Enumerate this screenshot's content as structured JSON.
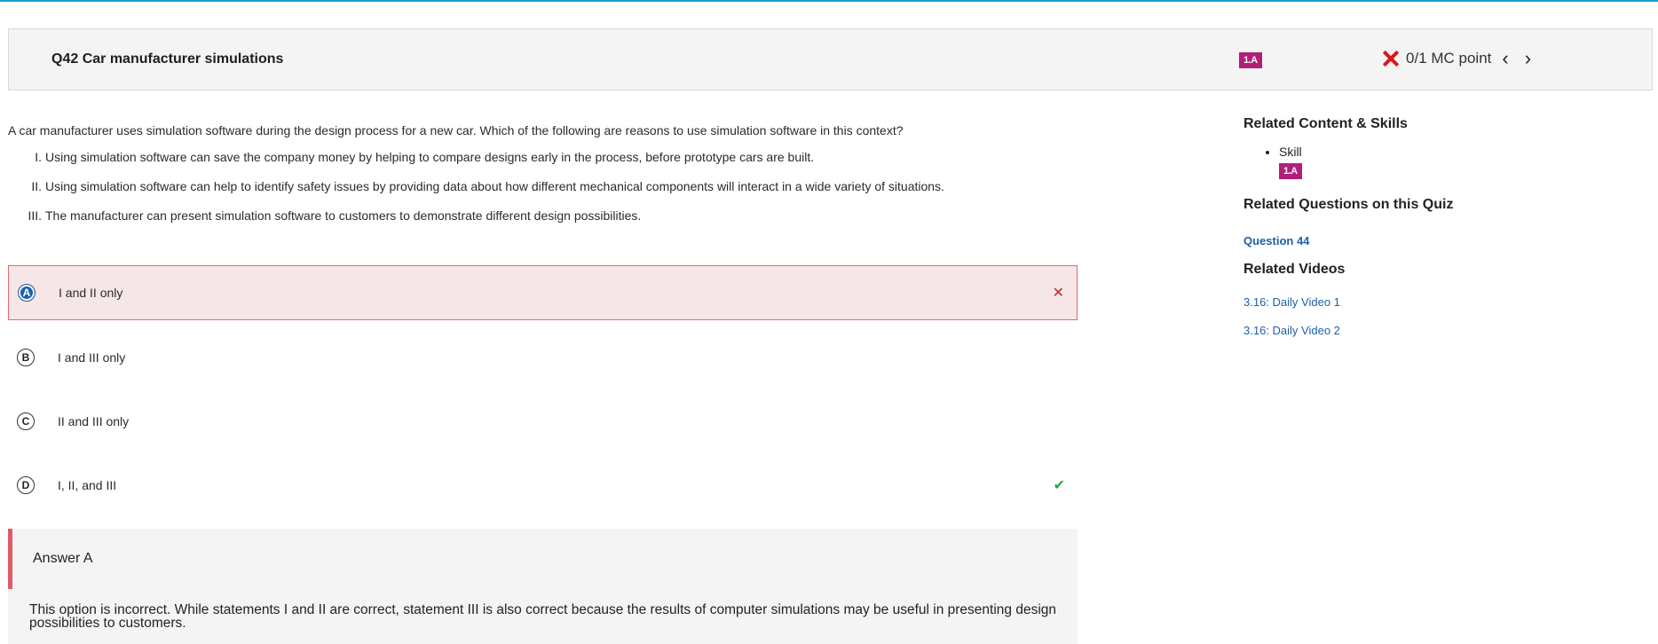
{
  "header": {
    "title": "Q42 Car manufacturer simulations",
    "skill_badge": "1.A",
    "score": "0/1 MC point",
    "prev_label": "‹",
    "next_label": "›"
  },
  "question": {
    "stem": "A car manufacturer uses simulation software during the design process for a new car. Which of the following are reasons to use simulation software in this context?",
    "statements": [
      {
        "num": "I.",
        "text": "Using simulation software can save the company money by helping to compare designs early in the process, before prototype cars are built."
      },
      {
        "num": "II.",
        "text": "Using simulation software can help to identify safety issues by providing data about how different mechanical components will interact in a wide variety of situations."
      },
      {
        "num": "III.",
        "text": "The manufacturer can present simulation software to customers to demonstrate different design possibilities."
      }
    ]
  },
  "options": [
    {
      "letter": "A",
      "text": "I and II only",
      "status": "✕"
    },
    {
      "letter": "B",
      "text": "I and III only"
    },
    {
      "letter": "C",
      "text": "II and III only"
    },
    {
      "letter": "D",
      "text": "I, II, and III",
      "status": "✔"
    }
  ],
  "answer": {
    "title": "Answer A",
    "body": "This option is incorrect. While statements I and II are correct, statement III is also correct because the results of computer simulations may be useful in presenting design possibilities to customers."
  },
  "sidebar": {
    "content_heading": "Related Content & Skills",
    "skill_label": "Skill",
    "skill_badge": "1.A",
    "questions_heading": "Related Questions on this Quiz",
    "question_link": "Question 44",
    "videos_heading": "Related Videos",
    "videos": [
      "3.16: Daily Video 1",
      "3.16: Daily Video 2"
    ]
  },
  "colors": {
    "accent_top": "#1aa0d8",
    "badge": "#b21f79",
    "incorrect": "#d7191f",
    "correct": "#2aa34a",
    "link": "#1f5fa8"
  }
}
